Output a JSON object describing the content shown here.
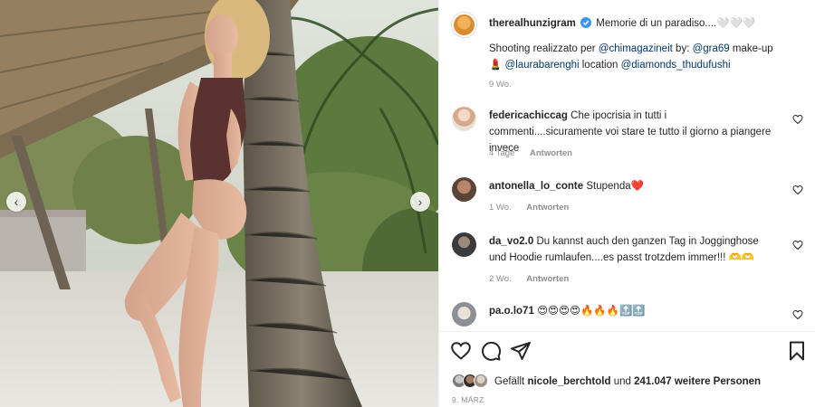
{
  "post": {
    "author": "therealhunzigram",
    "caption": "Memorie di un paradiso....",
    "caption_emoji": "🤍🤍🤍",
    "credits_pre": "Shooting realizzato per",
    "credit_magazine": "@chimagazineit",
    "credits_by": "by:",
    "credit_photographer": "@gra69",
    "credits_makeup": "make-up",
    "makeup_emoji": "💄",
    "credit_makeup": "@laurabarenghi",
    "credits_location": "location",
    "credit_location": "@diamonds_thudufushi",
    "time": "9 Wo.",
    "liked_by_pre": "Gefällt",
    "liked_by_user": "nicole_berchtold",
    "liked_by_mid": "und",
    "likes_count": "241.047 weitere Personen",
    "date": "9. MÄRZ"
  },
  "comments": [
    {
      "user": "federicachiccag",
      "text": "Che ipocrisia in tutti i commenti....sicuramente voi stare te tutto il giorno a piangere invece",
      "time": "4 Tage",
      "reply": "Antworten"
    },
    {
      "user": "antonella_lo_conte",
      "text": "Stupenda❤️",
      "time": "1 Wo.",
      "reply": "Antworten"
    },
    {
      "user": "da_vo2.0",
      "text": "Du kannst auch den ganzen Tag in Jogginghose und Hoodie rumlaufen....es passt trotzdem immer!!! 🫶🫶",
      "time": "2 Wo.",
      "reply": "Antworten"
    },
    {
      "user": "pa.o.lo71",
      "text": "😍😍😍😍🔥🔥🔥🔝🔝",
      "time": "",
      "reply": ""
    }
  ],
  "icons": {
    "like": "heart-icon",
    "comment": "comment-icon",
    "share": "send-icon",
    "save": "bookmark-icon",
    "prev": "chevron-left-icon",
    "next": "chevron-right-icon"
  },
  "colors": {
    "link": "#00376b",
    "verified": "#3897f0",
    "muted": "#8e8e8e"
  }
}
